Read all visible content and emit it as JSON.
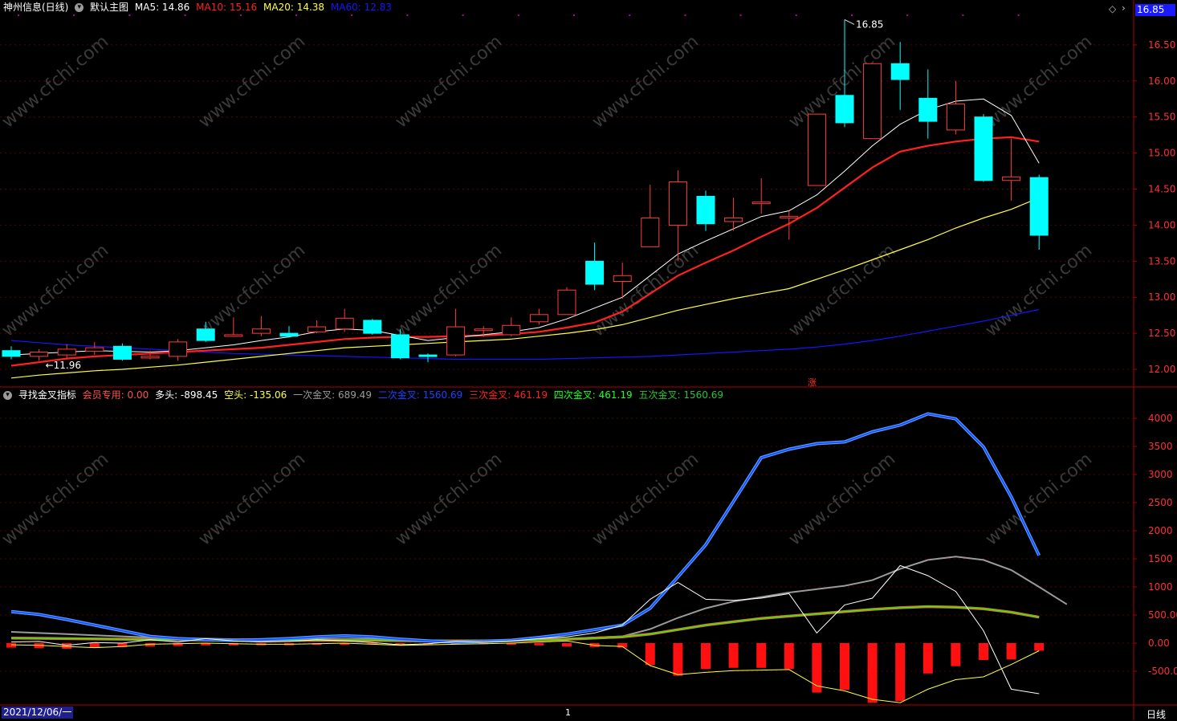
{
  "header": {
    "stock_title": "神州信息(日线)",
    "main_chart_label": "默认主图",
    "ma5": {
      "label": "MA5: 14.86",
      "color": "#ffffff"
    },
    "ma10": {
      "label": "MA10: 15.16",
      "color": "#ff2020"
    },
    "ma20": {
      "label": "MA20: 14.38",
      "color": "#ffff40"
    },
    "ma60": {
      "label": "MA60: 12.83",
      "color": "#1515ff"
    }
  },
  "indicator_header": {
    "name": "寻找金叉指标",
    "member": {
      "label": "会员专用: 0.00",
      "color": "#ff5050"
    },
    "bull": {
      "label": "多头: -898.45",
      "color": "#ffffff"
    },
    "bear": {
      "label": "空头: -135.06",
      "color": "#ffff40"
    },
    "first": {
      "label": "一次金叉: 689.49",
      "color": "#9a9a9a"
    },
    "second": {
      "label": "二次金叉: 1560.69",
      "color": "#2040ff"
    },
    "third": {
      "label": "三次金叉: 461.19",
      "color": "#ff2020"
    },
    "fourth": {
      "label": "四次金叉: 461.19",
      "color": "#20ff20"
    },
    "fifth": {
      "label": "五次金叉: 1560.69",
      "color": "#30c030"
    }
  },
  "current_price": "16.85",
  "high_annotation": "16.85",
  "low_annotation": "←11.96",
  "rise_marker": "涨",
  "bottom_date": "2021/12/06/一",
  "cursor_marker": "1",
  "period_tab": "日线",
  "watermark": "www.cfchi.com",
  "price_axis": [
    "16.50",
    "16.00",
    "15.50",
    "15.00",
    "14.50",
    "14.00",
    "13.50",
    "13.00",
    "12.50",
    "12.00"
  ],
  "indicator_axis": [
    "4000",
    "3500",
    "3000",
    "2500",
    "2000",
    "1500",
    "1000",
    "500.00",
    "0.00",
    "-500.00"
  ],
  "chart_data": {
    "type": "candlestick",
    "price_range": [
      11.8,
      16.9
    ],
    "indicator_range": [
      -1100,
      4300
    ],
    "candles": [
      [
        12.26,
        12.18,
        12.32,
        12.14
      ],
      [
        12.18,
        12.24,
        12.28,
        12.12
      ],
      [
        12.2,
        12.28,
        12.35,
        12.15
      ],
      [
        12.25,
        12.3,
        12.38,
        12.2
      ],
      [
        12.32,
        12.14,
        12.36,
        12.12
      ],
      [
        12.16,
        12.18,
        12.26,
        12.14
      ],
      [
        12.18,
        12.38,
        12.42,
        12.12
      ],
      [
        12.56,
        12.4,
        12.66,
        12.38
      ],
      [
        12.46,
        12.48,
        12.72,
        12.45
      ],
      [
        12.5,
        12.56,
        12.74,
        12.46
      ],
      [
        12.5,
        12.46,
        12.6,
        12.44
      ],
      [
        12.52,
        12.59,
        12.68,
        12.5
      ],
      [
        12.56,
        12.71,
        12.84,
        12.52
      ],
      [
        12.68,
        12.5,
        12.7,
        12.48
      ],
      [
        12.48,
        12.16,
        12.56,
        12.14
      ],
      [
        12.2,
        12.19,
        12.22,
        12.1
      ],
      [
        12.2,
        12.59,
        12.84,
        12.18
      ],
      [
        12.56,
        12.56,
        12.6,
        12.45
      ],
      [
        12.48,
        12.61,
        12.72,
        12.46
      ],
      [
        12.66,
        12.76,
        12.84,
        12.62
      ],
      [
        12.76,
        13.1,
        13.14,
        12.8
      ],
      [
        13.5,
        13.18,
        13.76,
        13.1
      ],
      [
        13.22,
        13.3,
        13.48,
        12.98
      ],
      [
        13.7,
        14.1,
        14.56,
        13.7
      ],
      [
        14.0,
        14.6,
        14.76,
        13.5
      ],
      [
        14.4,
        14.02,
        14.48,
        13.92
      ],
      [
        14.05,
        14.1,
        14.38,
        13.92
      ],
      [
        14.32,
        14.32,
        14.65,
        14.16
      ],
      [
        14.1,
        14.12,
        14.2,
        13.8
      ],
      [
        14.55,
        15.54,
        15.54,
        14.55
      ],
      [
        15.8,
        15.42,
        16.85,
        15.36
      ],
      [
        15.2,
        16.24,
        16.24,
        15.2
      ],
      [
        16.24,
        16.02,
        16.54,
        15.6
      ],
      [
        15.76,
        15.44,
        16.16,
        15.2
      ],
      [
        15.32,
        15.68,
        16.0,
        15.26
      ],
      [
        15.5,
        14.62,
        15.54,
        14.6
      ],
      [
        14.62,
        14.67,
        15.2,
        14.34
      ],
      [
        14.66,
        13.86,
        14.7,
        13.66
      ]
    ],
    "ma5": [
      12.2,
      12.22,
      12.24,
      12.26,
      12.25,
      12.24,
      12.26,
      12.3,
      12.34,
      12.4,
      12.45,
      12.52,
      12.56,
      12.54,
      12.47,
      12.4,
      12.44,
      12.48,
      12.52,
      12.58,
      12.7,
      12.85,
      13.0,
      13.3,
      13.6,
      13.78,
      13.95,
      14.12,
      14.2,
      14.42,
      14.75,
      15.1,
      15.4,
      15.6,
      15.72,
      15.75,
      15.52,
      14.86
    ],
    "ma10": [
      12.05,
      12.1,
      12.15,
      12.18,
      12.2,
      12.22,
      12.24,
      12.26,
      12.28,
      12.3,
      12.34,
      12.38,
      12.42,
      12.44,
      12.45,
      12.45,
      12.46,
      12.47,
      12.49,
      12.52,
      12.58,
      12.65,
      12.8,
      13.05,
      13.3,
      13.48,
      13.65,
      13.84,
      14.02,
      14.24,
      14.52,
      14.8,
      15.02,
      15.1,
      15.16,
      15.2,
      15.22,
      15.16
    ],
    "ma20": [
      11.88,
      11.92,
      11.95,
      11.98,
      12.0,
      12.03,
      12.06,
      12.1,
      12.14,
      12.18,
      12.22,
      12.26,
      12.3,
      12.32,
      12.34,
      12.36,
      12.38,
      12.4,
      12.42,
      12.46,
      12.5,
      12.55,
      12.62,
      12.72,
      12.82,
      12.9,
      12.98,
      13.05,
      13.12,
      13.25,
      13.38,
      13.52,
      13.66,
      13.8,
      13.96,
      14.1,
      14.22,
      14.38
    ],
    "ma60": [
      12.4,
      12.37,
      12.34,
      12.32,
      12.3,
      12.28,
      12.26,
      12.24,
      12.22,
      12.21,
      12.2,
      12.19,
      12.18,
      12.17,
      12.16,
      12.15,
      12.14,
      12.14,
      12.14,
      12.14,
      12.15,
      12.16,
      12.17,
      12.18,
      12.2,
      12.22,
      12.24,
      12.26,
      12.28,
      12.31,
      12.35,
      12.4,
      12.46,
      12.53,
      12.6,
      12.67,
      12.75,
      12.83
    ],
    "series_second": [
      560,
      510,
      420,
      320,
      220,
      120,
      80,
      60,
      50,
      60,
      80,
      110,
      130,
      110,
      70,
      40,
      20,
      30,
      50,
      100,
      160,
      240,
      320,
      620,
      1180,
      1750,
      2520,
      3300,
      3450,
      3550,
      3580,
      3760,
      3880,
      4080,
      3990,
      3490,
      2600,
      1560
    ],
    "series_first": [
      200,
      180,
      160,
      140,
      120,
      100,
      90,
      80,
      70,
      70,
      70,
      70,
      75,
      70,
      60,
      50,
      40,
      40,
      50,
      60,
      80,
      100,
      120,
      250,
      450,
      620,
      740,
      820,
      900,
      960,
      1020,
      1120,
      1320,
      1480,
      1540,
      1480,
      1300,
      1000,
      690
    ],
    "series_third": [
      90,
      85,
      80,
      75,
      70,
      65,
      60,
      55,
      52,
      50,
      50,
      50,
      50,
      48,
      45,
      40,
      38,
      40,
      45,
      55,
      70,
      90,
      110,
      160,
      240,
      320,
      380,
      440,
      480,
      520,
      560,
      600,
      630,
      650,
      640,
      610,
      550,
      461
    ],
    "series_bull": [
      20,
      30,
      -40,
      10,
      0,
      60,
      20,
      80,
      40,
      20,
      30,
      60,
      40,
      10,
      -30,
      -10,
      30,
      20,
      40,
      80,
      110,
      180,
      320,
      780,
      1080,
      780,
      760,
      800,
      880,
      180,
      680,
      800,
      1380,
      1200,
      920,
      220,
      -820,
      -900
    ],
    "series_bear": [
      -30,
      -40,
      -60,
      -80,
      -60,
      -20,
      -10,
      0,
      -10,
      -20,
      -20,
      -10,
      0,
      -20,
      -40,
      -30,
      -20,
      -10,
      0,
      20,
      40,
      -40,
      -60,
      -400,
      -560,
      -520,
      -490,
      -480,
      -470,
      -760,
      -850,
      -1000,
      -1060,
      -820,
      -650,
      -600,
      -380,
      -135
    ],
    "bars": [
      -80,
      -90,
      -100,
      -80,
      -70,
      -60,
      -50,
      -40,
      -40,
      -40,
      -40,
      -30,
      -30,
      -20,
      -20,
      -20,
      -20,
      -20,
      -30,
      -40,
      -60,
      -70,
      -80,
      -390,
      -580,
      -460,
      -440,
      -440,
      -460,
      -880,
      -830,
      -1060,
      -1030,
      -540,
      -410,
      -300,
      -290,
      -135
    ]
  }
}
